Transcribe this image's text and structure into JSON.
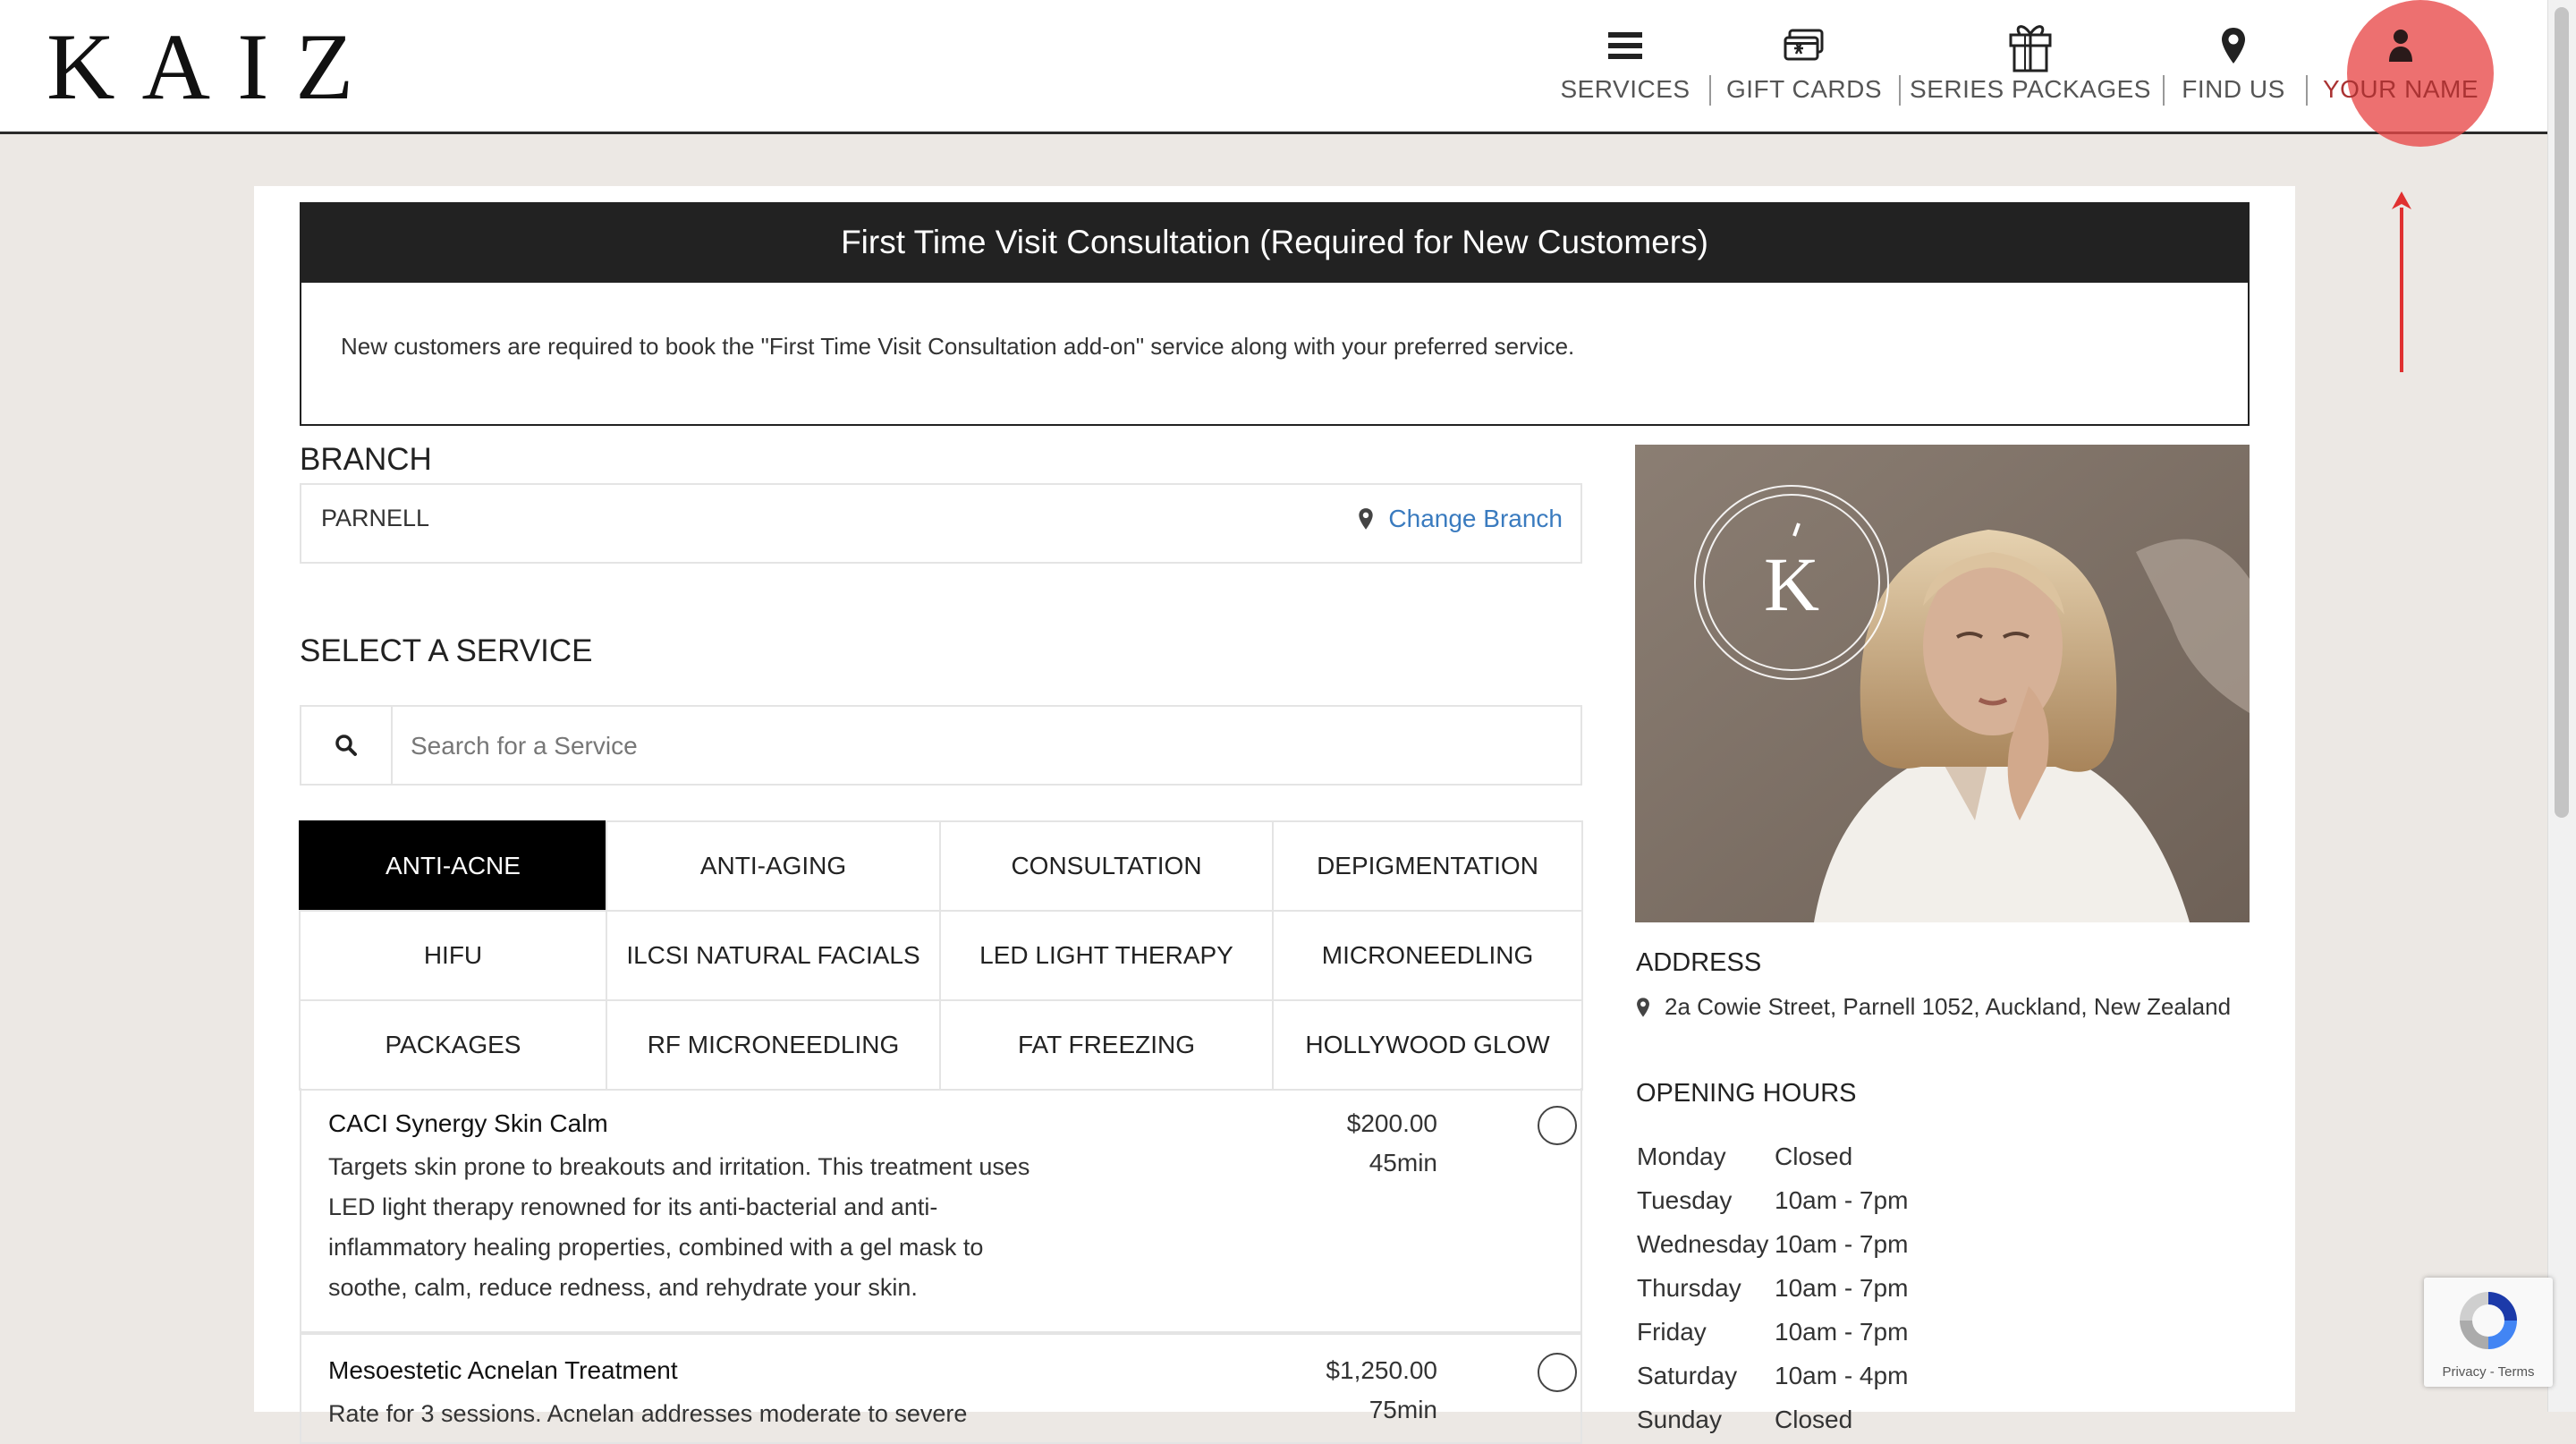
{
  "header": {
    "logo": "KAIZ",
    "nav": [
      {
        "label": "SERVICES",
        "icon": "hamburger-menu-icon"
      },
      {
        "label": "GIFT CARDS",
        "icon": "gift-card-icon"
      },
      {
        "label": "SERIES PACKAGES",
        "icon": "gift-box-icon"
      },
      {
        "label": "FIND US",
        "icon": "map-pin-icon"
      },
      {
        "label": "YOUR NAME",
        "icon": "user-icon"
      }
    ]
  },
  "notice": {
    "title": "First Time Visit Consultation (Required for New Customers)",
    "body": "New customers are required to book the \"First Time Visit Consultation add-on\" service along with your preferred service."
  },
  "branch": {
    "heading": "BRANCH",
    "name": "PARNELL",
    "change_label": "Change Branch"
  },
  "service_select": {
    "heading": "SELECT A SERVICE",
    "search_placeholder": "Search for a Service",
    "tabs": [
      "ANTI-ACNE",
      "ANTI-AGING",
      "CONSULTATION",
      "DEPIGMENTATION",
      "HIFU",
      "ILCSI NATURAL FACIALS",
      "LED LIGHT THERAPY",
      "MICRONEEDLING",
      "PACKAGES",
      "RF MICRONEEDLING",
      "FAT FREEZING",
      "HOLLYWOOD GLOW"
    ],
    "active_tab": "ANTI-ACNE",
    "services": [
      {
        "name": "CACI Synergy Skin Calm",
        "description": "Targets skin prone to breakouts and irritation. This treatment uses LED light therapy renowned for its anti-bacterial and anti-inflammatory healing properties, combined with a gel mask to soothe, calm, reduce redness, and rehydrate your skin.",
        "price": "$200.00",
        "duration": "45min"
      },
      {
        "name": "Mesoestetic Acnelan Treatment",
        "description": "Rate for 3 sessions. Acnelan addresses moderate to severe",
        "price": "$1,250.00",
        "duration": "75min"
      }
    ]
  },
  "location": {
    "photo_logo": "K",
    "address_heading": "ADDRESS",
    "address": "2a Cowie Street, Parnell 1052, Auckland, New Zealand",
    "hours_heading": "OPENING HOURS",
    "hours": [
      {
        "day": "Monday",
        "time": "Closed"
      },
      {
        "day": "Tuesday",
        "time": "10am - 7pm"
      },
      {
        "day": "Wednesday",
        "time": "10am - 7pm"
      },
      {
        "day": "Thursday",
        "time": "10am - 7pm"
      },
      {
        "day": "Friday",
        "time": "10am - 7pm"
      },
      {
        "day": "Saturday",
        "time": "10am - 4pm"
      },
      {
        "day": "Sunday",
        "time": "Closed"
      }
    ]
  },
  "recaptcha": {
    "label": "Privacy - Terms"
  },
  "colors": {
    "accent_link": "#3a7bbf",
    "highlight": "#e84848",
    "dark": "#222222"
  }
}
